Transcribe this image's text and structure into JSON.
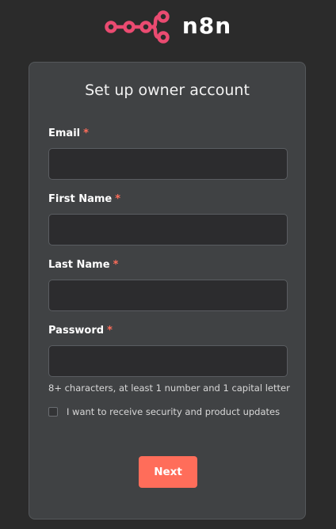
{
  "brand": {
    "name": "n8n",
    "logo_icon": "n8n-logo-icon",
    "logo_color": "#ea4b71"
  },
  "card": {
    "title": "Set up owner account"
  },
  "fields": {
    "email": {
      "label": "Email",
      "required": "*",
      "value": ""
    },
    "first_name": {
      "label": "First Name",
      "required": "*",
      "value": ""
    },
    "last_name": {
      "label": "Last Name",
      "required": "*",
      "value": ""
    },
    "password": {
      "label": "Password",
      "required": "*",
      "value": ""
    }
  },
  "password_hint": "8+ characters, at least 1 number and 1 capital letter",
  "updates_checkbox": {
    "label": "I want to receive security and product updates",
    "checked": false
  },
  "next_button": {
    "label": "Next"
  },
  "colors": {
    "background": "#2b2b2b",
    "card": "#404244",
    "accent": "#ff6d5a",
    "input_bg": "#2c2c2e"
  }
}
